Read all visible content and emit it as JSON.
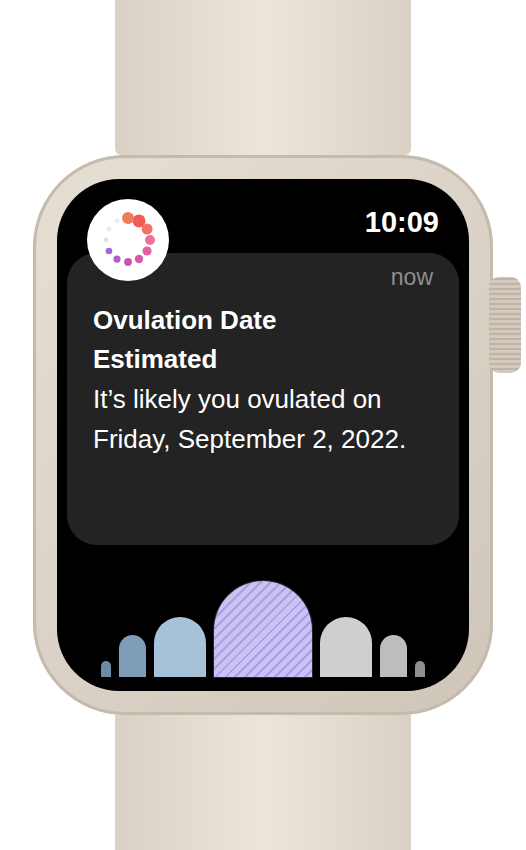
{
  "status_bar": {
    "time": "10:09"
  },
  "notification": {
    "timestamp": "now",
    "title": "Ovulation Date Estimated",
    "body": "It’s likely you ovulated on Friday, September 2, 2022."
  },
  "cycle_days": [
    {
      "color": "#6f8aa6",
      "kind": "solid",
      "selected": false
    },
    {
      "color": "#7f9cb8",
      "kind": "solid",
      "selected": false
    },
    {
      "color": "#a7c1d9",
      "kind": "solid",
      "selected": false
    },
    {
      "color": "#c9c2f3",
      "kind": "striped",
      "selected": true
    },
    {
      "color": "#cfcfcf",
      "kind": "solid",
      "selected": false
    },
    {
      "color": "#bdbdbd",
      "kind": "solid",
      "selected": false
    },
    {
      "color": "#8e8e8e",
      "kind": "solid",
      "selected": false
    }
  ]
}
